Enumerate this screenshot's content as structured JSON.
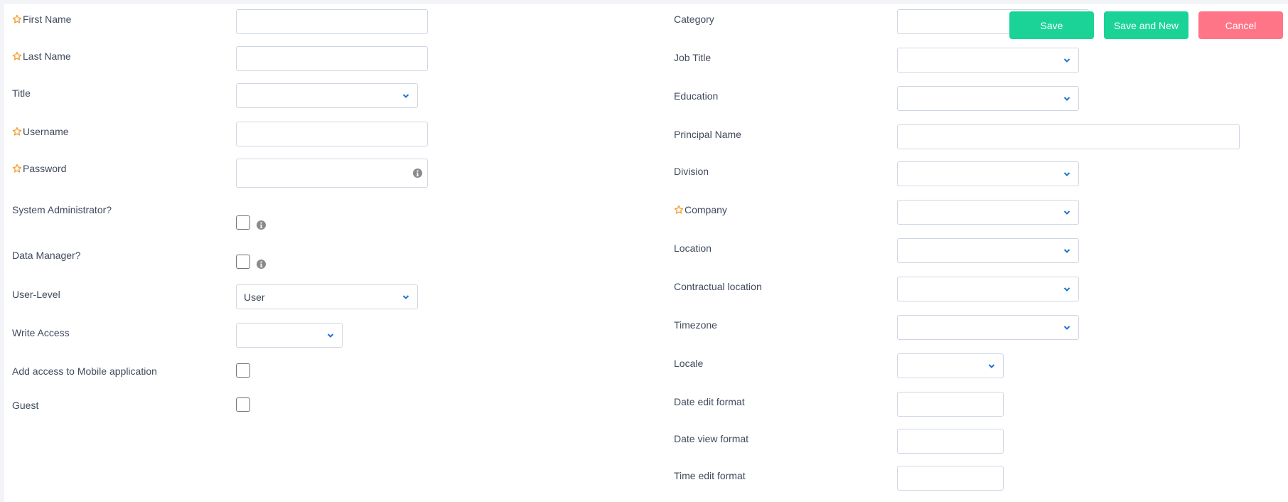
{
  "colors": {
    "required_star": "#f39c2a",
    "chevron": "#1c74d4",
    "save": "#1bd396",
    "cancel": "#ff7588",
    "info_icon": "#8a8a8a"
  },
  "actions": {
    "save_label": "Save",
    "save_and_new_label": "Save and New",
    "cancel_label": "Cancel"
  },
  "left": {
    "first_name": {
      "label": "First Name",
      "required": true,
      "value": ""
    },
    "last_name": {
      "label": "Last Name",
      "required": true,
      "value": ""
    },
    "title": {
      "label": "Title",
      "value": ""
    },
    "username": {
      "label": "Username",
      "required": true,
      "value": ""
    },
    "password": {
      "label": "Password",
      "required": true,
      "value": "",
      "icon": "info-icon"
    },
    "system_admin": {
      "label": "System Administrator?",
      "checked": false,
      "icon": "info-icon"
    },
    "data_manager": {
      "label": "Data Manager?",
      "checked": false,
      "icon": "info-icon"
    },
    "user_level": {
      "label": "User-Level",
      "value": "User"
    },
    "write_access": {
      "label": "Write Access",
      "value": ""
    },
    "mobile_access": {
      "label": "Add access to Mobile application",
      "checked": false
    },
    "guest": {
      "label": "Guest",
      "checked": false
    }
  },
  "right": {
    "category": {
      "label": "Category",
      "value": ""
    },
    "job_title": {
      "label": "Job Title",
      "value": ""
    },
    "education": {
      "label": "Education",
      "value": ""
    },
    "principal_name": {
      "label": "Principal Name",
      "value": ""
    },
    "division": {
      "label": "Division",
      "value": ""
    },
    "company": {
      "label": "Company",
      "required": true,
      "value": ""
    },
    "location": {
      "label": "Location",
      "value": ""
    },
    "contractual_location": {
      "label": "Contractual location",
      "value": ""
    },
    "timezone": {
      "label": "Timezone",
      "value": ""
    },
    "locale": {
      "label": "Locale",
      "value": ""
    },
    "date_edit_format": {
      "label": "Date edit format",
      "value": ""
    },
    "date_view_format": {
      "label": "Date view format",
      "value": ""
    },
    "time_edit_format": {
      "label": "Time edit format",
      "value": ""
    }
  }
}
